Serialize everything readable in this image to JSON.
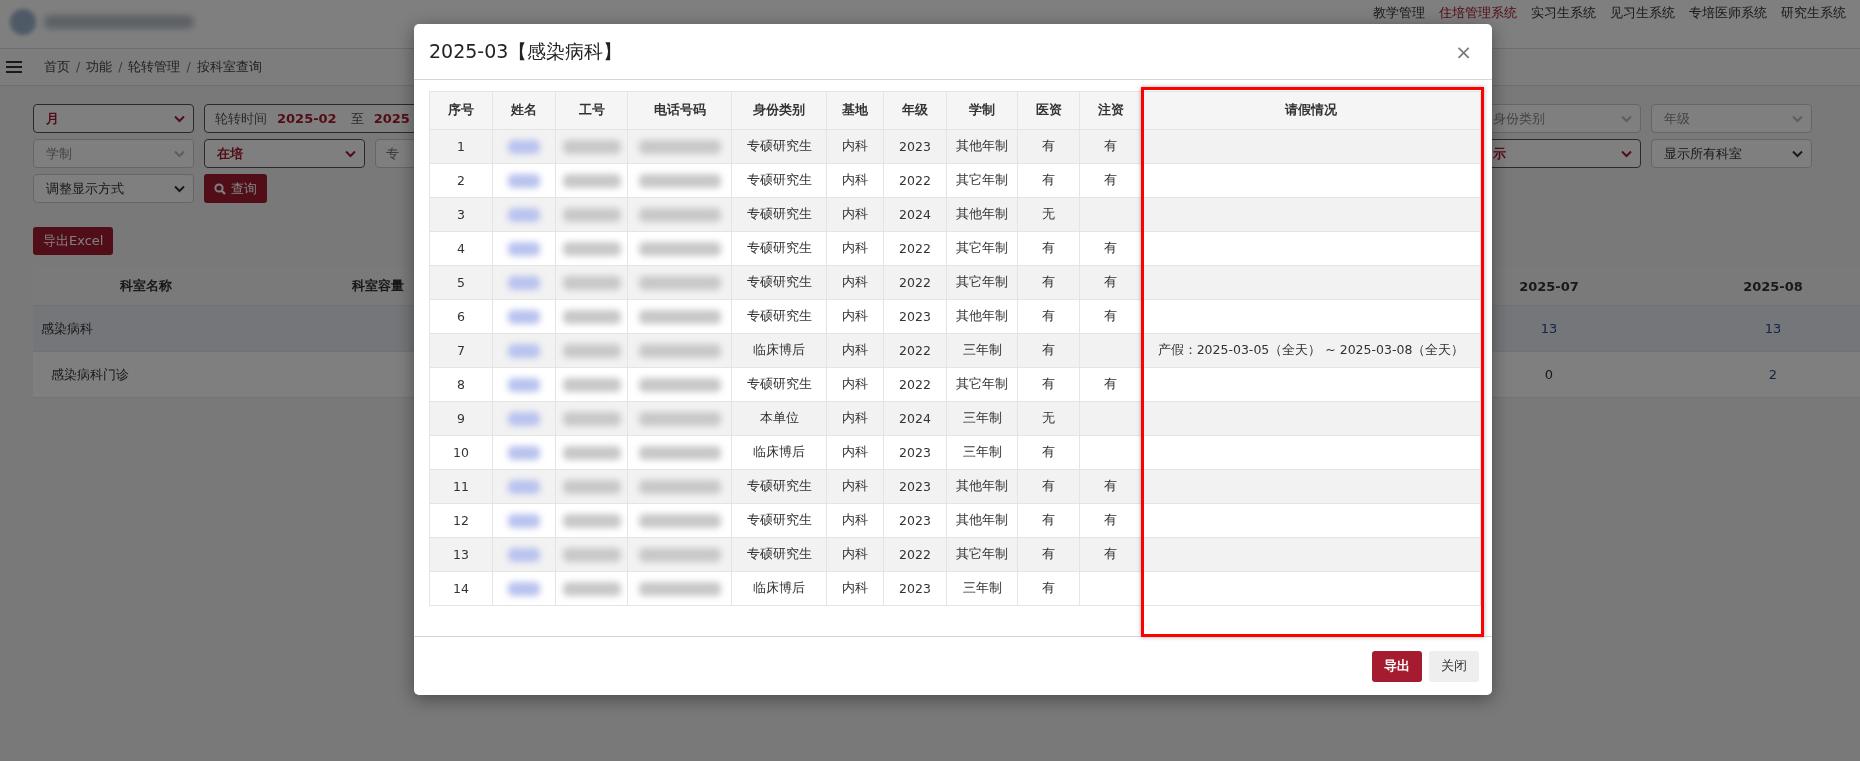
{
  "header": {
    "nav": [
      {
        "label": "教学管理",
        "selected": false
      },
      {
        "label": "住培管理系统",
        "selected": true
      },
      {
        "label": "实习生系统",
        "selected": false
      },
      {
        "label": "见习生系统",
        "selected": false
      },
      {
        "label": "专培医师系统",
        "selected": false
      },
      {
        "label": "研究生系统",
        "selected": false
      }
    ]
  },
  "breadcrumb": {
    "separator": "/",
    "items": [
      "首页",
      "功能",
      "轮转管理",
      "按科室查询"
    ]
  },
  "filter_rows": [
    {
      "left": [
        {
          "kind": "select",
          "value": "月",
          "active": true
        },
        {
          "kind": "range",
          "label": "轮转时间",
          "from": "2025-02",
          "sep": "至",
          "to": "2025"
        }
      ],
      "right": [
        {
          "kind": "select",
          "placeholder": "身份类别",
          "active": false
        },
        {
          "kind": "select",
          "placeholder": "年级",
          "active": false
        }
      ]
    },
    {
      "left": [
        {
          "kind": "select",
          "placeholder": "学制",
          "active": false
        },
        {
          "kind": "select",
          "value": "在培",
          "active": true
        },
        {
          "kind": "text",
          "placeholder": "专"
        }
      ],
      "right": [
        {
          "kind": "select",
          "value": "示",
          "active": true
        },
        {
          "kind": "select",
          "value": "显示所有科室",
          "active": false
        }
      ]
    },
    {
      "left": [
        {
          "kind": "select",
          "value": "调整显示方式",
          "active": false
        },
        {
          "kind": "button",
          "label": "查询"
        }
      ],
      "right": []
    }
  ],
  "export_button": "导出Excel",
  "dept_table": {
    "columns": [
      "科室名称",
      "科室容量",
      "2025-07",
      "2025-08"
    ],
    "rows": [
      {
        "kind": "group",
        "name": "感染病科",
        "cells": [
          {
            "text": "13",
            "link": true
          },
          {
            "text": "13",
            "link": true
          }
        ]
      },
      {
        "kind": "sub",
        "name": "感染病科门诊",
        "cells": [
          {
            "text": "0",
            "link": false
          },
          {
            "text": "2",
            "link": true
          }
        ]
      }
    ]
  },
  "dialog": {
    "title": "2025-03【感染病科】",
    "close": "×",
    "columns": [
      "序号",
      "姓名",
      "工号",
      "电话号码",
      "身份类别",
      "基地",
      "年级",
      "学制",
      "医资",
      "注资",
      "请假情况"
    ],
    "rows": [
      {
        "no": "1",
        "identity": "专硕研究生",
        "base": "内科",
        "grade": "2023",
        "system": "其他年制",
        "yizi": "有",
        "zhuzi": "有"
      },
      {
        "no": "2",
        "identity": "专硕研究生",
        "base": "内科",
        "grade": "2022",
        "system": "其它年制",
        "yizi": "有",
        "zhuzi": "有"
      },
      {
        "no": "3",
        "identity": "专硕研究生",
        "base": "内科",
        "grade": "2024",
        "system": "其他年制",
        "yizi": "无"
      },
      {
        "no": "4",
        "identity": "专硕研究生",
        "base": "内科",
        "grade": "2022",
        "system": "其它年制",
        "yizi": "有",
        "zhuzi": "有"
      },
      {
        "no": "5",
        "identity": "专硕研究生",
        "base": "内科",
        "grade": "2022",
        "system": "其它年制",
        "yizi": "有",
        "zhuzi": "有"
      },
      {
        "no": "6",
        "identity": "专硕研究生",
        "base": "内科",
        "grade": "2023",
        "system": "其他年制",
        "yizi": "有",
        "zhuzi": "有"
      },
      {
        "no": "7",
        "identity": "临床博后",
        "base": "内科",
        "grade": "2022",
        "system": "三年制",
        "yizi": "有",
        "leave": "产假：2025-03-05（全天） ~ 2025-03-08（全天）"
      },
      {
        "no": "8",
        "identity": "专硕研究生",
        "base": "内科",
        "grade": "2022",
        "system": "其它年制",
        "yizi": "有",
        "zhuzi": "有"
      },
      {
        "no": "9",
        "identity": "本单位",
        "base": "内科",
        "grade": "2024",
        "system": "三年制",
        "yizi": "无"
      },
      {
        "no": "10",
        "identity": "临床博后",
        "base": "内科",
        "grade": "2023",
        "system": "三年制",
        "yizi": "有"
      },
      {
        "no": "11",
        "identity": "专硕研究生",
        "base": "内科",
        "grade": "2023",
        "system": "其他年制",
        "yizi": "有",
        "zhuzi": "有"
      },
      {
        "no": "12",
        "identity": "专硕研究生",
        "base": "内科",
        "grade": "2023",
        "system": "其他年制",
        "yizi": "有",
        "zhuzi": "有"
      },
      {
        "no": "13",
        "identity": "专硕研究生",
        "base": "内科",
        "grade": "2022",
        "system": "其它年制",
        "yizi": "有",
        "zhuzi": "有"
      },
      {
        "no": "14",
        "identity": "临床博后",
        "base": "内科",
        "grade": "2023",
        "system": "三年制",
        "yizi": "有"
      }
    ],
    "buttons": [
      {
        "label": "导出",
        "kind": "primary"
      },
      {
        "label": "关闭",
        "kind": "default"
      }
    ]
  }
}
